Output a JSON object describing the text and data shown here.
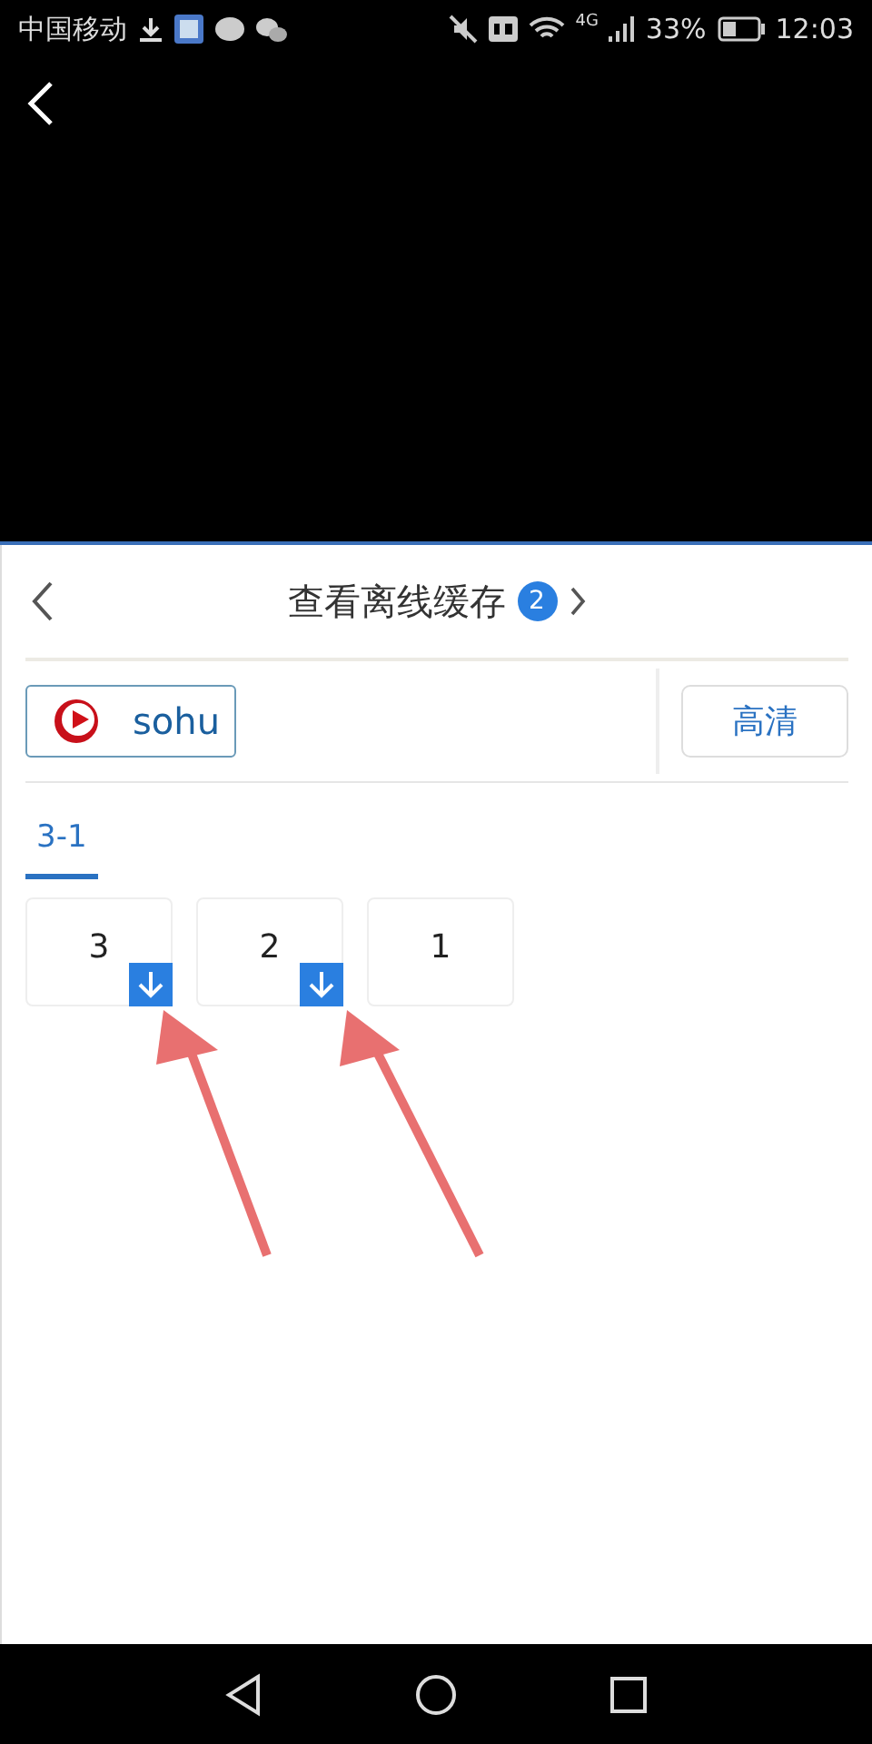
{
  "status_bar": {
    "carrier": "中国移动",
    "battery": "33%",
    "time": "12:03",
    "network": "4G"
  },
  "panel": {
    "title": "查看离线缓存",
    "count": "2",
    "source": "sohu",
    "quality": "高清",
    "tabs": [
      {
        "label": "3-1",
        "selected": true
      }
    ],
    "episodes": [
      {
        "label": "3",
        "downloaded": true
      },
      {
        "label": "2",
        "downloaded": true
      },
      {
        "label": "1",
        "downloaded": false
      }
    ]
  }
}
